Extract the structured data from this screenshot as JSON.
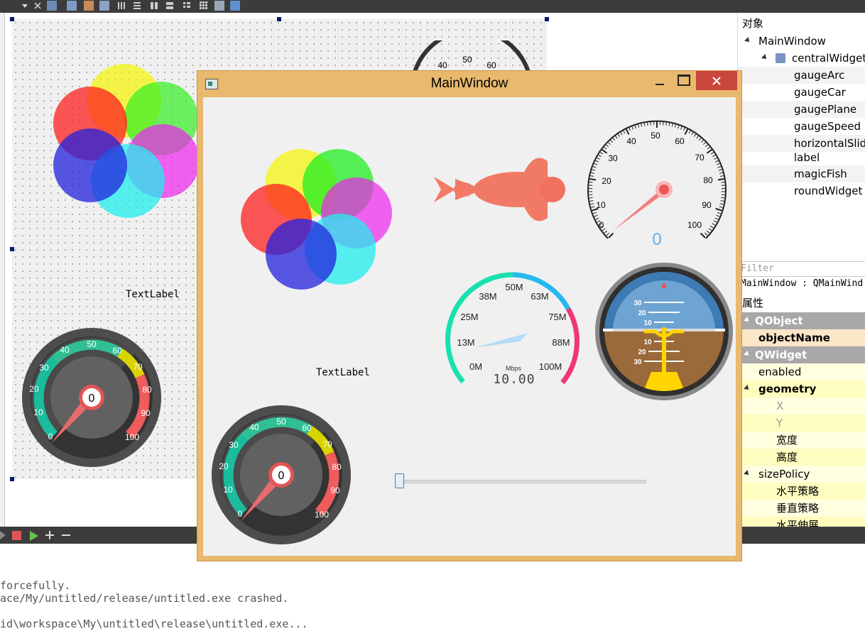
{
  "designer": {
    "text_label": "TextLabel",
    "car_gauge": {
      "value": "0",
      "ticks": [
        "0",
        "10",
        "20",
        "30",
        "40",
        "50",
        "60",
        "70",
        "80",
        "90",
        "100"
      ]
    },
    "speed_ticks_partial": [
      "40",
      "50",
      "60"
    ]
  },
  "main_window": {
    "title": "MainWindow",
    "text_label": "TextLabel",
    "arc_gauge": {
      "ticks": [
        "0",
        "10",
        "20",
        "30",
        "40",
        "50",
        "60",
        "70",
        "80",
        "90",
        "100"
      ],
      "value": "0"
    },
    "speed_gauge": {
      "ticks": [
        "0M",
        "13M",
        "25M",
        "38M",
        "50M",
        "63M",
        "75M",
        "88M",
        "100M"
      ],
      "unit": "Mbps",
      "value": "10.00"
    },
    "car_gauge": {
      "value": "0",
      "ticks": [
        "0",
        "10",
        "20",
        "30",
        "40",
        "50",
        "60",
        "70",
        "80",
        "90",
        "100"
      ]
    },
    "plane_gauge": {
      "pitch_labels": [
        "30",
        "20",
        "10",
        "10",
        "20",
        "30"
      ]
    },
    "slider": {
      "value": 0
    }
  },
  "object_inspector": {
    "title": "对象",
    "items": [
      "MainWindow",
      "centralWidget",
      "gaugeArc",
      "gaugeCar",
      "gaugePlane",
      "gaugeSpeed",
      "horizontalSlid",
      "label",
      "magicFish",
      "roundWidget"
    ]
  },
  "property_editor": {
    "filter_placeholder": "Filter",
    "class_line": "MainWindow : QMainWind",
    "header": "属性",
    "rows": [
      "QObject",
      "objectName",
      "QWidget",
      "enabled",
      "geometry",
      "X",
      "Y",
      "宽度",
      "高度",
      "sizePolicy",
      "水平策略",
      "垂直策略",
      "水平伸展"
    ]
  },
  "output": {
    "lines": [
      "forcefully.",
      "ace/My/untitled/release/untitled.exe crashed.",
      "",
      "id\\workspace\\My\\untitled\\release\\untitled.exe..."
    ]
  },
  "colors": {
    "accent_window": "#e9b96e",
    "close_button": "#c9463d",
    "property_category": "#a8a8a8"
  }
}
